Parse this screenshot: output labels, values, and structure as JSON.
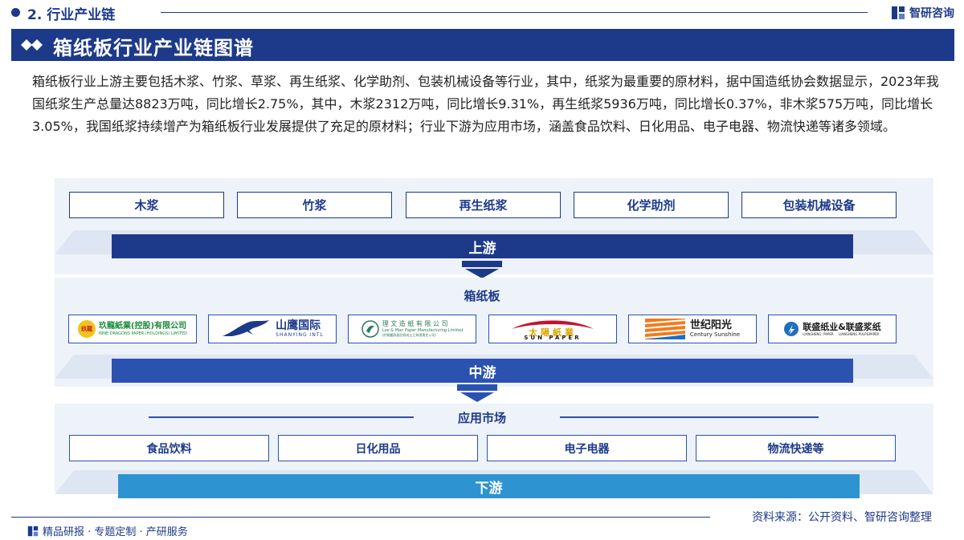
{
  "header": {
    "section_title": "2. 行业产业链",
    "brand": "智研咨询"
  },
  "banner": {
    "title": "箱纸板行业产业链图谱"
  },
  "intro": "箱纸板行业上游主要包括木浆、竹浆、草浆、再生纸浆、化学助剂、包装机械设备等行业，其中，纸浆为最重要的原材料，据中国造纸协会数据显示，2023年我国纸浆生产总量达8823万吨，同比增长2.75%，其中，木浆2312万吨，同比增长9.31%，再生纸浆5936万吨，同比增长0.37%，非木浆575万吨，同比增长3.05%，我国纸浆持续增产为箱纸板行业发展提供了充足的原材料；行业下游为应用市场，涵盖食品饮料、日化用品、电子电器、物流快递等诸多领域。",
  "upstream": {
    "items": [
      "木浆",
      "竹浆",
      "再生纸浆",
      "化学助剂",
      "包装机械设备"
    ],
    "bar_label": "上游"
  },
  "midstream": {
    "label": "箱纸板",
    "bar_label": "中游",
    "companies": [
      {
        "name": "玖龍紙業(控股)有限公司",
        "sub": "NINE DRAGONS PAPER (HOLDINGS) LIMITED",
        "badge": "玖龍",
        "color": "#1a8a3a"
      },
      {
        "name": "山鹰国际",
        "sub": "SHANYING INTL",
        "color": "#1d3a8a"
      },
      {
        "name": "理 文 造 紙 有 限 公 司",
        "sub": "Lee & Man Paper Manufacturing Limited",
        "sub2": "(於開曼群島註冊成立之有限責任公司)",
        "color": "#2a7a5a"
      },
      {
        "name": "太陽紙業",
        "sub": "SUN PAPER",
        "color": "#c8102e"
      },
      {
        "name": "世纪阳光",
        "sub": "Century Sunshine",
        "color": "#1d3a8a"
      },
      {
        "name": "联盛纸业&联盛浆纸",
        "sub": "LIANSHENG  PAPER     LIANSHENG PULP&PAPER",
        "color": "#1d3a8a"
      }
    ]
  },
  "downstream": {
    "label": "应用市场",
    "items": [
      "食品饮料",
      "日化用品",
      "电子电器",
      "物流快递等"
    ],
    "bar_label": "下游"
  },
  "footer": {
    "source": "资料来源：公开资料、智研咨询整理",
    "slogan": "精品研报 · 专题定制 · 产研服务"
  },
  "colors": {
    "primary": "#1d3a8a",
    "mid": "#2b52b0",
    "light": "#2e93d1",
    "panel": "#eef2f9"
  }
}
